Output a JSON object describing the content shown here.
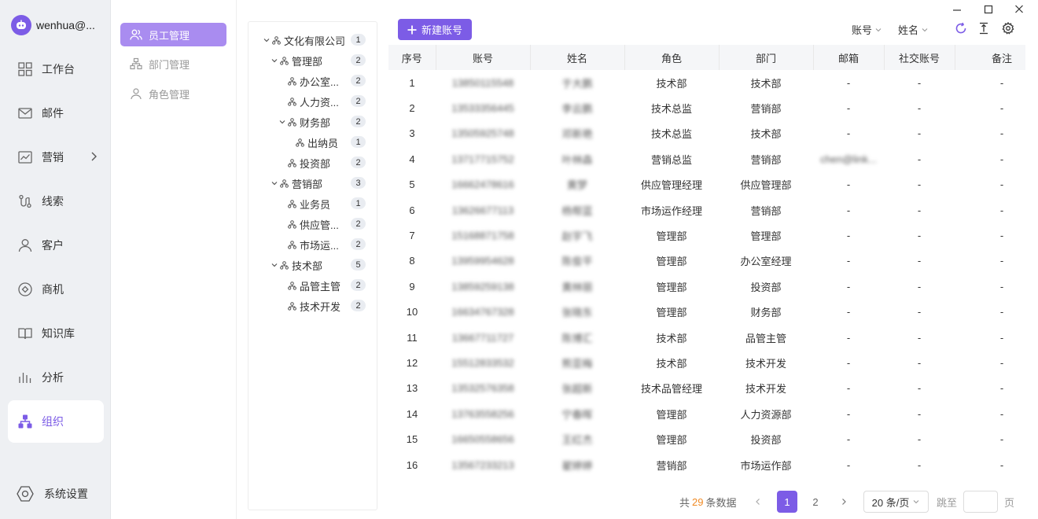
{
  "user": {
    "name": "wenhua@..."
  },
  "nav": {
    "items": [
      {
        "key": "dashboard",
        "label": "工作台",
        "icon": "grid-icon"
      },
      {
        "key": "mail",
        "label": "邮件",
        "icon": "mail-icon"
      },
      {
        "key": "marketing",
        "label": "营销",
        "icon": "chart-line-icon"
      },
      {
        "key": "leads",
        "label": "线索",
        "icon": "route-icon"
      },
      {
        "key": "customers",
        "label": "客户",
        "icon": "user-icon"
      },
      {
        "key": "opportunities",
        "label": "商机",
        "icon": "target-icon"
      },
      {
        "key": "knowledge",
        "label": "知识库",
        "icon": "book-icon"
      },
      {
        "key": "analytics",
        "label": "分析",
        "icon": "bars-icon"
      },
      {
        "key": "org",
        "label": "组织",
        "icon": "org-icon"
      }
    ],
    "settings_label": "系统设置"
  },
  "submenu": {
    "items": [
      {
        "label": "员工管理",
        "icon": "users-icon"
      },
      {
        "label": "部门管理",
        "icon": "org-icon"
      },
      {
        "label": "角色管理",
        "icon": "user-icon"
      }
    ]
  },
  "tree": {
    "nodes": [
      {
        "label": "文化有限公司",
        "count": "1",
        "level": 0,
        "expandable": true
      },
      {
        "label": "管理部",
        "count": "2",
        "level": 1,
        "expandable": true
      },
      {
        "label": "办公室...",
        "count": "2",
        "level": 2,
        "expandable": false
      },
      {
        "label": "人力资...",
        "count": "2",
        "level": 2,
        "expandable": false
      },
      {
        "label": "财务部",
        "count": "2",
        "level": 2,
        "expandable": true
      },
      {
        "label": "出纳员",
        "count": "1",
        "level": 3,
        "expandable": false
      },
      {
        "label": "投资部",
        "count": "2",
        "level": 2,
        "expandable": false
      },
      {
        "label": "营销部",
        "count": "3",
        "level": 1,
        "expandable": true
      },
      {
        "label": "业务员",
        "count": "1",
        "level": 2,
        "expandable": false
      },
      {
        "label": "供应管...",
        "count": "2",
        "level": 2,
        "expandable": false
      },
      {
        "label": "市场运...",
        "count": "2",
        "level": 2,
        "expandable": false
      },
      {
        "label": "技术部",
        "count": "5",
        "level": 1,
        "expandable": true
      },
      {
        "label": "品管主管",
        "count": "2",
        "level": 2,
        "expandable": false
      },
      {
        "label": "技术开发",
        "count": "2",
        "level": 2,
        "expandable": false
      }
    ]
  },
  "toolbar": {
    "new_label": "新建账号",
    "filter_account": "账号",
    "filter_name": "姓名"
  },
  "table": {
    "columns": [
      "序号",
      "账号",
      "姓名",
      "角色",
      "部门",
      "邮箱",
      "社交账号",
      "备注"
    ],
    "rows": [
      [
        "1",
        "13850115548",
        "于大鹏",
        "技术部",
        "技术部",
        "-",
        "-",
        "-"
      ],
      [
        "2",
        "13533356445",
        "李云鹏",
        "技术总监",
        "营销部",
        "-",
        "-",
        "-"
      ],
      [
        "3",
        "13505925748",
        "邓新艳",
        "技术总监",
        "技术部",
        "-",
        "-",
        "-"
      ],
      [
        "4",
        "13717715752",
        "叶林森",
        "营销总监",
        "营销部",
        "chen@link...",
        "-",
        "-"
      ],
      [
        "5",
        "16662478616",
        "黄梦",
        "供应管理经理",
        "供应管理部",
        "-",
        "-",
        "-"
      ],
      [
        "6",
        "13626677113",
        "杨帮蓝",
        "市场运作经理",
        "营销部",
        "-",
        "-",
        "-"
      ],
      [
        "7",
        "15168871758",
        "赵宇飞",
        "管理部",
        "管理部",
        "-",
        "-",
        "-"
      ],
      [
        "8",
        "13959954628",
        "陈俊平",
        "管理部",
        "办公室经理",
        "-",
        "-",
        "-"
      ],
      [
        "9",
        "13859259138",
        "黄林丽",
        "管理部",
        "投资部",
        "-",
        "-",
        "-"
      ],
      [
        "10",
        "16634767328",
        "张晓东",
        "管理部",
        "财务部",
        "-",
        "-",
        "-"
      ],
      [
        "11",
        "13667711727",
        "陈博汇",
        "技术部",
        "品管主管",
        "-",
        "-",
        "-"
      ],
      [
        "12",
        "15512833532",
        "熊亚梅",
        "技术部",
        "技术开发",
        "-",
        "-",
        "-"
      ],
      [
        "13",
        "13532576358",
        "张超新",
        "技术品管经理",
        "技术开发",
        "-",
        "-",
        "-"
      ],
      [
        "14",
        "13763558256",
        "宁春晖",
        "管理部",
        "人力资源部",
        "-",
        "-",
        "-"
      ],
      [
        "15",
        "16650558656",
        "王红杰",
        "管理部",
        "投资部",
        "-",
        "-",
        "-"
      ],
      [
        "16",
        "13567233213",
        "翟婷婷",
        "营销部",
        "市场运作部",
        "-",
        "-",
        "-"
      ]
    ]
  },
  "pagination": {
    "total_prefix": "共",
    "total": "29",
    "total_suffix": "条数据",
    "pages": [
      "1",
      "2"
    ],
    "current": "1",
    "page_size": "20 条/页",
    "jump_label": "跳至",
    "page_suffix": "页"
  },
  "colors": {
    "accent": "#7c5ce6",
    "accent_light": "#a98cf0",
    "total_highlight": "#f08a24"
  }
}
